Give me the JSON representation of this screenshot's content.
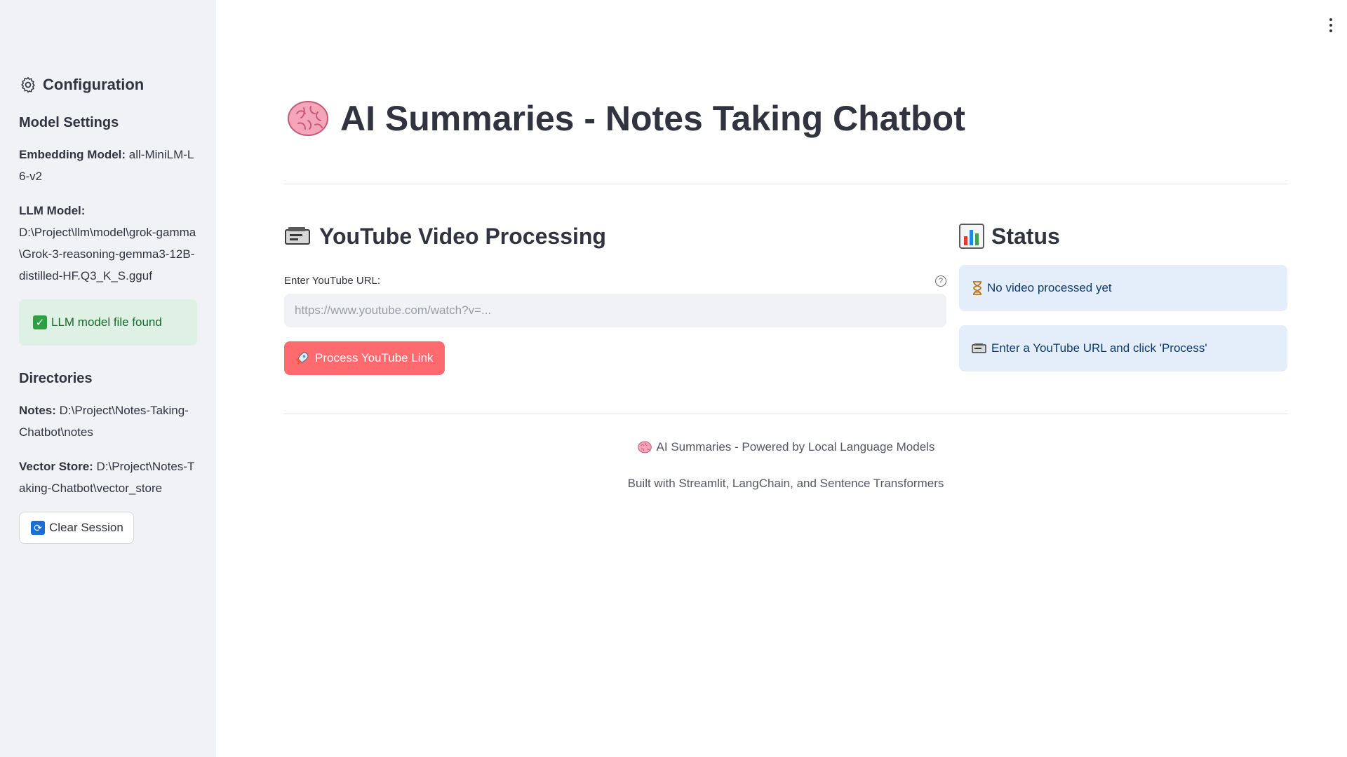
{
  "sidebar": {
    "title": "Configuration",
    "model_settings": {
      "heading": "Model Settings",
      "embedding_label": "Embedding Model:",
      "embedding_value": "all-MiniLM-L6-v2",
      "llm_label": "LLM Model:",
      "llm_value": "D:\\Project\\llm\\model\\grok-gamma\\Grok-3-reasoning-gemma3-12B-distilled-HF.Q3_K_S.gguf",
      "success_text": "LLM model file found"
    },
    "directories": {
      "heading": "Directories",
      "notes_label": "Notes:",
      "notes_value": "D:\\Project\\Notes-Taking-Chatbot\\notes",
      "vector_label": "Vector Store:",
      "vector_value": "D:\\Project\\Notes-Taking-Chatbot\\vector_store"
    },
    "clear_button": "Clear Session"
  },
  "main": {
    "title": "AI Summaries - Notes Taking Chatbot",
    "youtube_section": {
      "heading": "YouTube Video Processing",
      "input_label": "Enter YouTube URL:",
      "input_value": "",
      "input_placeholder": "https://www.youtube.com/watch?v=...",
      "process_button": "Process YouTube Link"
    },
    "status_section": {
      "heading": "Status",
      "messages": [
        "No video processed yet",
        "Enter a YouTube URL and click 'Process'"
      ]
    },
    "footer": {
      "line1": "AI Summaries - Powered by Local Language Models",
      "line2": "Built with Streamlit, LangChain, and Sentence Transformers"
    }
  },
  "colors": {
    "sidebar_bg": "#f0f2f6",
    "primary_button": "#ff6a6e",
    "success_bg": "#dff0e4",
    "info_bg": "#e4eefb"
  }
}
